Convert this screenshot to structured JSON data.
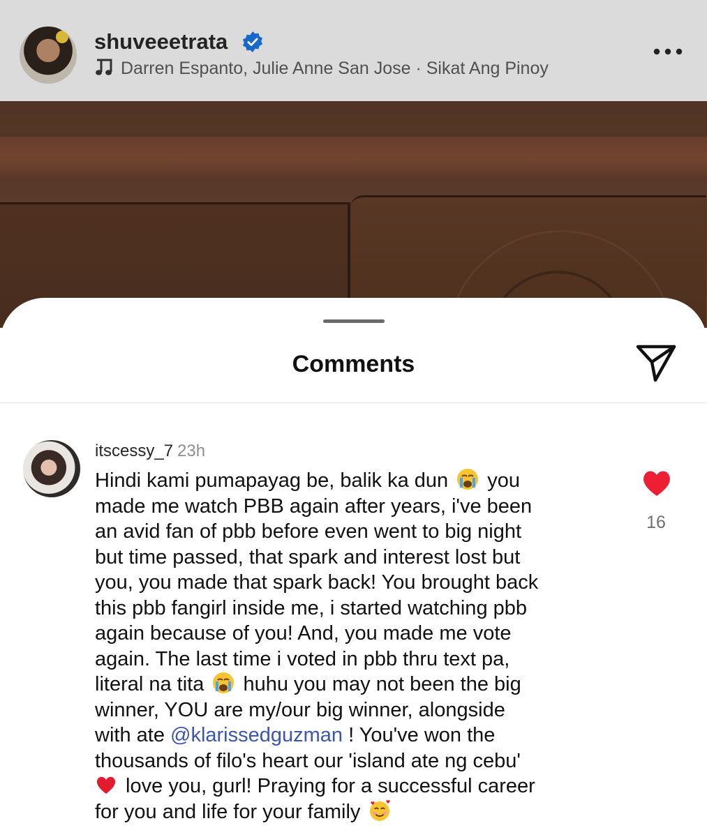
{
  "header": {
    "username": "shuveeetrata",
    "music_text": "Darren Espanto, Julie Anne San Jose · Sikat Ang Pinoy"
  },
  "sheet": {
    "title": "Comments"
  },
  "comment": {
    "username": "itscessy_7",
    "time": "23h",
    "lines": [
      [
        "Hindi kami pumapayag be, balik ka dun ",
        "",
        " you"
      ],
      [
        "made me watch PBB again after years, i've been"
      ],
      [
        "an avid fan of pbb before even went to big night"
      ],
      [
        "but time passed, that spark and interest lost but"
      ],
      [
        "you, you made that spark back! You brought back"
      ],
      [
        "this pbb fangirl inside me, i started watching pbb"
      ],
      [
        "again because of you! And, you made me vote"
      ],
      [
        "again. The last time i voted in pbb thru text pa,"
      ],
      [
        "literal na tita ",
        "",
        " huhu you may not been the big"
      ],
      [
        "winner, YOU are my/our big winner, alongside"
      ],
      [
        "with ate ",
        "@klarissedguzman",
        " ! You've won the"
      ],
      [
        "thousands of filo's heart our 'island ate ng cebu'"
      ],
      [
        "",
        " love you, gurl! Praying for a successful career"
      ],
      [
        "for you and life for your family ",
        ""
      ]
    ],
    "likes": "16"
  },
  "colors": {
    "mention": "#3b55b0",
    "heart": "#ed1f34",
    "verified": "#1a6fd6"
  },
  "icons": {
    "verified": "verified-badge-icon",
    "music": "music-note-icon",
    "more": "more-options-icon",
    "share": "send-paper-plane-icon",
    "like": "heart-filled-icon",
    "crying": "loudly-crying-face-emoji",
    "heart_emoji": "red-heart-emoji",
    "smiling_hearts": "smiling-face-with-hearts-emoji"
  }
}
